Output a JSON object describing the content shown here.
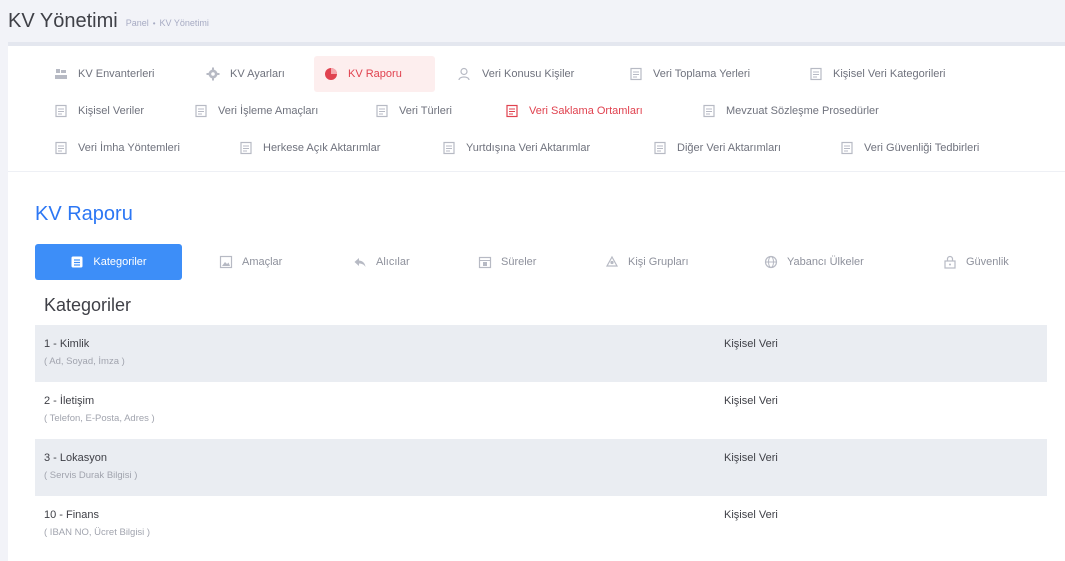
{
  "header": {
    "title": "KV Yönetimi",
    "breadcrumb": [
      "Panel",
      "KV Yönetimi"
    ]
  },
  "topnav": [
    {
      "label": "KV Envanterleri",
      "icon": "inventory-icon"
    },
    {
      "label": "KV Ayarları",
      "icon": "gear-icon"
    },
    {
      "label": "KV Raporu",
      "icon": "report-icon"
    },
    {
      "label": "Veri Konusu Kişiler",
      "icon": "user-icon"
    },
    {
      "label": "Veri Toplama Yerleri",
      "icon": "document-icon"
    },
    {
      "label": "Kişisel Veri Kategorileri",
      "icon": "document-icon"
    },
    {
      "label": "Kişisel Veriler",
      "icon": "document-icon"
    },
    {
      "label": "Veri İşleme Amaçları",
      "icon": "document-icon"
    },
    {
      "label": "Veri Türleri",
      "icon": "document-icon"
    },
    {
      "label": "Veri Saklama Ortamları",
      "icon": "document-icon"
    },
    {
      "label": "Mevzuat Sözleşme Prosedürler",
      "icon": "document-icon"
    },
    {
      "label": "Veri İmha Yöntemleri",
      "icon": "document-icon"
    },
    {
      "label": "Herkese Açık Aktarımlar",
      "icon": "document-icon"
    },
    {
      "label": "Yurtdışına Veri Aktarımlar",
      "icon": "document-icon"
    },
    {
      "label": "Diğer Veri Aktarımları",
      "icon": "document-icon"
    },
    {
      "label": "Veri Güvenliği Tedbirleri",
      "icon": "document-icon"
    }
  ],
  "section_title": "KV Raporu",
  "tabs": [
    {
      "label": "Kategoriler",
      "icon": "list-icon"
    },
    {
      "label": "Amaçlar",
      "icon": "image-icon"
    },
    {
      "label": "Alıcılar",
      "icon": "reply-icon"
    },
    {
      "label": "Süreler",
      "icon": "calendar-icon"
    },
    {
      "label": "Kişi Grupları",
      "icon": "group-icon"
    },
    {
      "label": "Yabancı Ülkeler",
      "icon": "globe-icon"
    },
    {
      "label": "Güvenlik",
      "icon": "lock-icon"
    }
  ],
  "list": {
    "heading": "Kategoriler",
    "rows": [
      {
        "title": "1 - Kimlik",
        "subtitle": "( Ad, Soyad, İmza )",
        "type": "Kişisel Veri"
      },
      {
        "title": "2 - İletişim",
        "subtitle": "( Telefon, E-Posta, Adres )",
        "type": "Kişisel Veri"
      },
      {
        "title": "3 - Lokasyon",
        "subtitle": "( Servis Durak Bilgisi )",
        "type": "Kişisel Veri"
      },
      {
        "title": "10 - Finans",
        "subtitle": "( IBAN NO, Ücret Bilgisi )",
        "type": "Kişisel Veri"
      }
    ]
  },
  "colors": {
    "accent": "#3d8ef8",
    "title_blue": "#2c77f4",
    "danger": "#e0424f",
    "row_shade": "#eaedf2"
  }
}
